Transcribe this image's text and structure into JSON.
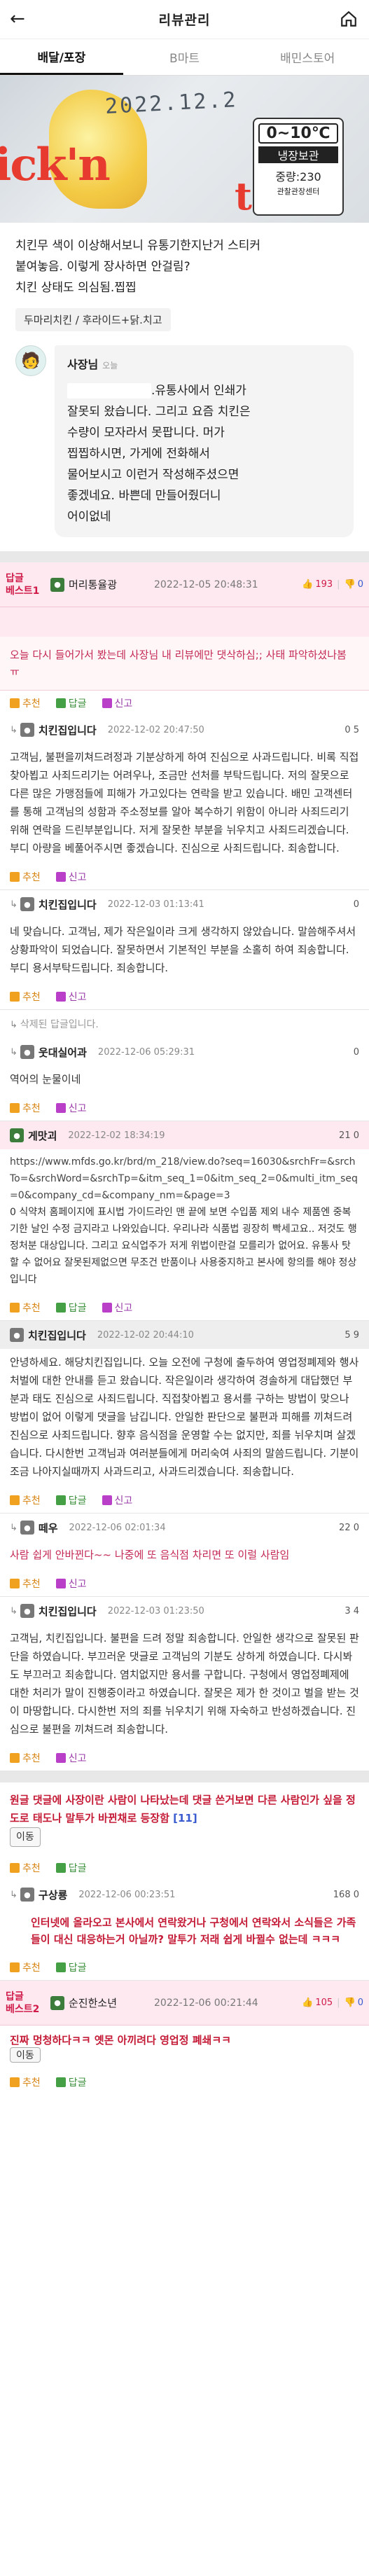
{
  "header": {
    "title": "리뷰관리"
  },
  "tabs": [
    {
      "label": "배달/포장"
    },
    {
      "label": "B마트"
    },
    {
      "label": "배민스토어"
    }
  ],
  "photo": {
    "date_stamp": "2022.12.2",
    "temp": "0~10℃",
    "storage": "냉장보관",
    "weight": "중량:230",
    "mark": "관찰관장센터",
    "logo1": "ick'n",
    "logo2": "the"
  },
  "review": {
    "lines": [
      "치킨무 색이 이상해서보니 유통기한지난거 스티커",
      "붙여놓음. 이렇게 장사하면 안걸림?",
      "치킨 상태도 의심됨.찝찝"
    ],
    "menu_tag": "두마리치킨 / 후라이드+닭.치고"
  },
  "owner": {
    "name": "사장님",
    "when": "오늘",
    "lines": [
      ".유통사에서 인쇄가",
      "잘못되 왔습니다. 그리고 요즘 치킨은",
      "수량이 모자라서 못팝니다. 머가",
      "찝찝하시면, 가게에 전화해서",
      "물어보시고 이런거 작성해주셨으면",
      "좋겠네요. 바쁜데 만들어줬더니",
      "어이없네"
    ]
  },
  "best1": {
    "badge1": "답글",
    "badge2": "베스트1",
    "user": "머리통율광",
    "date": "2022-12-05 20:48:31",
    "up": "193",
    "down": "0"
  },
  "post": {
    "text": "오늘 다시 들어가서 봤는데 사장님 내 리뷰에만 댓삭하심;; 사태 파악하셨나봄 ㅠ"
  },
  "actions": {
    "recommend": "추천",
    "reply": "답글",
    "report": "신고"
  },
  "comments": [
    {
      "name": "치킨집입니다",
      "date": "2022-12-02 20:47:50",
      "score": "0 5",
      "lines": [
        "고객님, 불편을끼쳐드려정과 기분상하게 하여 진심으로 사과드립니다. 비록 직접찾아뵙고 사죄드리기는 어려우나, 조금만 선처를 부탁드립니다. 저의 잘못으로 다른 많은 가맹점들에 피해가 가고있다는 연락을 받고 있습니다. 배민 고객센터를 통해 고객님의 성함과 주소정보를 알아 복수하기 위함이 아니라 사죄드리기 위해 연락을 드린부분입니다. 저게 잘못한 부분을 뉘우치고 사죄드리겠습니다. 부디 아량을 베풀어주시면 좋겠습니다. 진심으로 사죄드립니다. 죄송합니다."
      ]
    },
    {
      "name": "치킨집입니다",
      "date": "2022-12-03 01:13:41",
      "score": "0",
      "lines": [
        "네 맞습니다. 고객님, 제가 작은일이라 크게 생각하지 않았습니다. 말씀해주셔서 상황파악이 되었습니다. 잘못하면서 기본적인 부분을 소홀히 하여 죄송합니다. 부디 용서부탁드립니다. 죄송합니다."
      ]
    }
  ],
  "deleted": "삭제된 답글입니다.",
  "c3": {
    "name": "웃대실어과",
    "date": "2022-12-06 05:29:31",
    "score": "0",
    "text": "역어의 눈물이네"
  },
  "c4": {
    "name": "게맛괴",
    "date": "2022-12-02 18:34:19",
    "score": "21 0",
    "lines": [
      "https://www.mfds.go.kr/brd/m_218/view.do?seq=16030&srchFr=&srchTo=&srchWord=&srchTp=&itm_seq_1=0&itm_seq_2=0&multi_itm_seq=0&company_cd=&company_nm=&page=3",
      "0 식약처 홈페이지에 표시법 가이드라인 맨 끝에 보면 수입품 제외 내수 제품엔 중복기한 날인 수정 금지라고 나와있습니다. 우리나라 식품법 굉장히 빡세고요.. 저것도 행정처분 대상입니다. 그리고 요식업주가 저게 위법이란걸 모를리가 없어요. 유통사 탓 할 수 없어요 잘못된제없으면 무조건 반품이나 사용중지하고 본사에 항의를 해야 정상입니다"
    ]
  },
  "c5": {
    "name": "치킨집입니다",
    "date": "2022-12-02 20:44:10",
    "score": "5 9",
    "lines": [
      "안녕하세요. 해당치킨집입니다. 오늘 오전에 구청에 출두하여 영업정폐제와 행사처벌에 대한 안내를 듣고 왔습니다. 작은일이라 생각하여 경솔하게 대답했던 부분과 태도 진심으로 사죄드립니다. 직접찾아뵙고 용서를 구하는 방법이 맞으나 방법이 없어 이렇게 댓글을 남깁니다. 안일한 판단으로 불편과 피해를 끼쳐드려 진심으로 사죄드립니다. 향후 음식점을 운영할 수는 없지만, 죄를 뉘우치며 살겠습니다. 다시한번 고객님과 여러분들에게 머리숙여 사죄의 말씀드립니다. 기분이 조금 나아지실때까지 사과드리고, 사과드리겠습니다. 죄송합니다."
    ]
  },
  "c6": {
    "name": "떼우",
    "date": "2022-12-06 02:01:34",
    "score": "22 0",
    "lines": [
      "사람 쉽게 안바뀐다~~ 나중에 또 음식점 차리면 또 이럴 사람임"
    ]
  },
  "c7": {
    "name": "치킨집입니다",
    "date": "2022-12-03 01:23:50",
    "score": "3 4",
    "lines": [
      "고객님, 치킨집입니다. 불편을 드려 정말 죄송합니다. 안일한 생각으로 잘못된 판단을 하였습니다. 부끄러운 댓글로 고객님의 기분도 상하게 하였습니다. 다시봐도 부끄러고 죄송합니다. 염치없지만 용서를 구합니다. 구청에서 영업정폐제에 대한 처리가 말이 진행중이라고 하였습니다. 잘못은 제가 한 것이고 벌을 받는 것이 마땅합니다. 다시한번 저의 죄를 뉘우치기 위해 자숙하고 반성하겠습니다. 진심으로 불편을 끼쳐드려 죄송합니다."
    ]
  },
  "red_post": {
    "text": "원글 댓글에 사장이란 사람이 나타났는데 댓글 쓴거보면 다른 사람인가 싶을 정도로 태도나 말투가 바뀐채로 등장함",
    "count": "[11]",
    "pill": "이동"
  },
  "c8": {
    "name": "구상룡",
    "date": "2022-12-06 00:23:51",
    "score": "168 0",
    "text": "인터넷에 올라오고 본사에서 연락왔거나 구청에서 연락와서 소식들은 가족들이 대신 대응하는거 아닐까? 말투가 저래 쉽게 바뀔수 없는데 ㅋㅋㅋ"
  },
  "best2": {
    "badge1": "답글",
    "badge2": "베스트2",
    "user": "순진한소년",
    "date": "2022-12-06 00:21:44",
    "up": "105",
    "down": "0"
  },
  "final_post": {
    "text": "진짜 멍청하다ㅋㅋ 옛몬 아끼려다 영업정 폐쇄ㅋㅋ",
    "pill": "이동"
  }
}
